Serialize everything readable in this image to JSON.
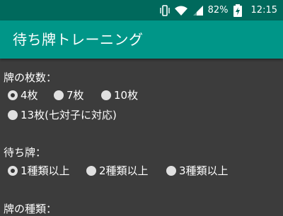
{
  "status_bar": {
    "battery": "82%",
    "time": "12:15",
    "icons": [
      "vibrate-icon",
      "wifi-icon",
      "signal-icon",
      "battery-charging-icon"
    ]
  },
  "app_bar": {
    "title": "待ち牌トレーニング"
  },
  "tile_count": {
    "label": "牌の枚数：",
    "options": [
      {
        "label": "4枚",
        "checked": true
      },
      {
        "label": "7枚",
        "checked": false
      },
      {
        "label": "10枚",
        "checked": false
      },
      {
        "label": "13枚(七対子に対応)",
        "checked": false
      }
    ]
  },
  "wait_tiles": {
    "label": "待ち牌：",
    "options": [
      {
        "label": "1種類以上",
        "checked": true
      },
      {
        "label": "2種類以上",
        "checked": false
      },
      {
        "label": "3種類以上",
        "checked": false
      }
    ]
  },
  "tile_types": {
    "label": "牌の種類："
  }
}
